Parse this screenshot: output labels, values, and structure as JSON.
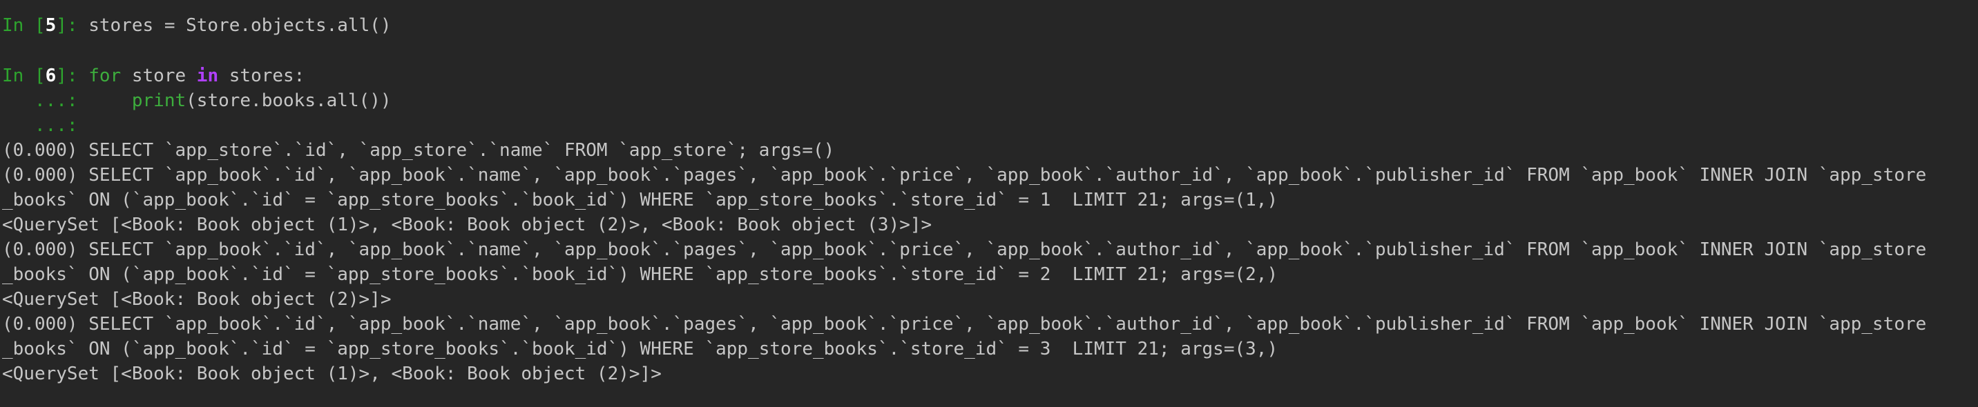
{
  "prompts": {
    "in_label": "In [",
    "in_close": "]: ",
    "cont": "   ...: ",
    "n5": "5",
    "n6": "6"
  },
  "cells": {
    "c5_code": "stores = Store.objects.all()",
    "c6_for": "for",
    "c6_mid1": " store ",
    "c6_in": "in",
    "c6_mid2": " stores:",
    "c6_indent": "    ",
    "c6_print": "print",
    "c6_print_args": "(store.books.all())"
  },
  "output": [
    "(0.000) SELECT `app_store`.`id`, `app_store`.`name` FROM `app_store`; args=()",
    "(0.000) SELECT `app_book`.`id`, `app_book`.`name`, `app_book`.`pages`, `app_book`.`price`, `app_book`.`author_id`, `app_book`.`publisher_id` FROM `app_book` INNER JOIN `app_store",
    "_books` ON (`app_book`.`id` = `app_store_books`.`book_id`) WHERE `app_store_books`.`store_id` = 1  LIMIT 21; args=(1,)",
    "<QuerySet [<Book: Book object (1)>, <Book: Book object (2)>, <Book: Book object (3)>]>",
    "(0.000) SELECT `app_book`.`id`, `app_book`.`name`, `app_book`.`pages`, `app_book`.`price`, `app_book`.`author_id`, `app_book`.`publisher_id` FROM `app_book` INNER JOIN `app_store",
    "_books` ON (`app_book`.`id` = `app_store_books`.`book_id`) WHERE `app_store_books`.`store_id` = 2  LIMIT 21; args=(2,)",
    "<QuerySet [<Book: Book object (2)>]>",
    "(0.000) SELECT `app_book`.`id`, `app_book`.`name`, `app_book`.`pages`, `app_book`.`price`, `app_book`.`author_id`, `app_book`.`publisher_id` FROM `app_book` INNER JOIN `app_store",
    "_books` ON (`app_book`.`id` = `app_store_books`.`book_id`) WHERE `app_store_books`.`store_id` = 3  LIMIT 21; args=(3,)",
    "<QuerySet [<Book: Book object (1)>, <Book: Book object (2)>]>"
  ],
  "colors": {
    "background": "#262626",
    "prompt_green": "#2ea52e",
    "keyword_purple": "#b040ff",
    "text": "#c6c6c6"
  }
}
